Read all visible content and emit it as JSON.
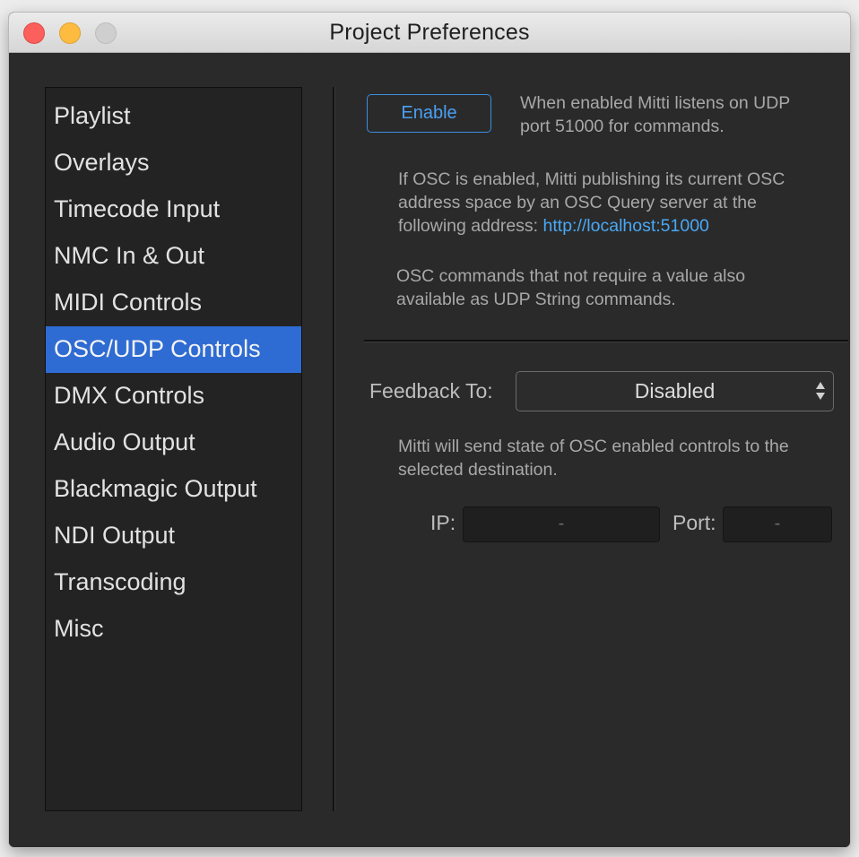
{
  "window": {
    "title": "Project Preferences"
  },
  "sidebar": {
    "selected_index": 5,
    "items": [
      {
        "label": "Playlist"
      },
      {
        "label": "Overlays"
      },
      {
        "label": "Timecode Input"
      },
      {
        "label": "NMC In & Out"
      },
      {
        "label": "MIDI Controls"
      },
      {
        "label": "OSC/UDP Controls"
      },
      {
        "label": "DMX Controls"
      },
      {
        "label": "Audio Output"
      },
      {
        "label": "Blackmagic Output"
      },
      {
        "label": "NDI Output"
      },
      {
        "label": "Transcoding"
      },
      {
        "label": "Misc"
      }
    ]
  },
  "main": {
    "enable_button": "Enable",
    "enable_description": "When enabled Mitti listens on UDP port 51000 for commands.",
    "osc_query_text": "If OSC is enabled, Mitti publishing its current OSC address space by an OSC Query server at the following address: ",
    "osc_query_link": "http://localhost:51000",
    "udp_string_text": "OSC commands that not require a value also available as UDP String commands.",
    "feedback_label": "Feedback To:",
    "feedback_value": "Disabled",
    "feedback_description": "Mitti will send state of OSC enabled controls to the selected destination.",
    "ip_label": "IP:",
    "ip_value": "-",
    "port_label": "Port:",
    "port_value": "-"
  },
  "colors": {
    "accent": "#2e6bd3",
    "link": "#4aa8f5",
    "background": "#2a2a2a"
  }
}
